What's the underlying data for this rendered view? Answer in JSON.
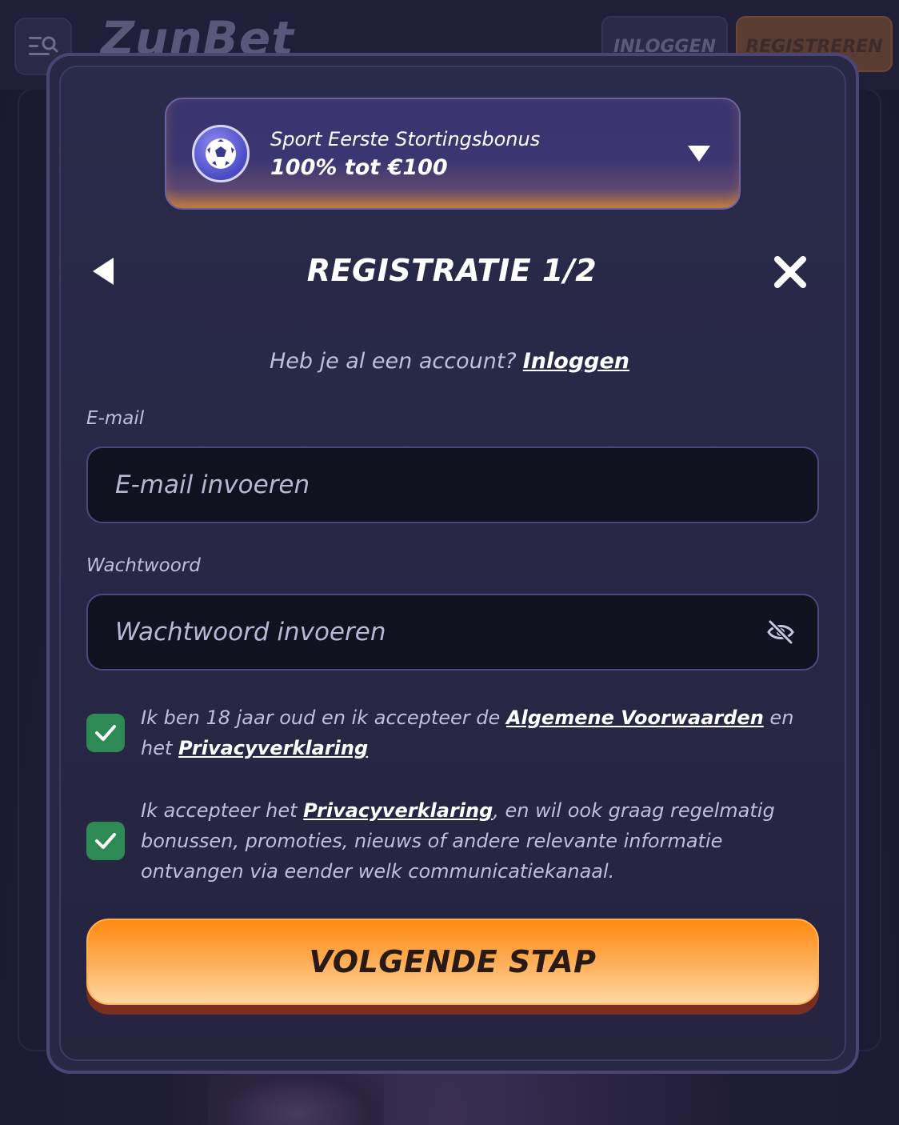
{
  "header": {
    "logo_text": "ZunBet",
    "login_label": "INLOGGEN",
    "register_label": "REGISTREREN"
  },
  "bonus": {
    "line1": "Sport Eerste Stortingsbonus",
    "line2": "100% tot €100",
    "icon": "soccer-ball-icon"
  },
  "modal": {
    "title": "REGISTRATIE 1/2",
    "have_account": "Heb je al een account?",
    "login_link": "Inloggen"
  },
  "form": {
    "email_label": "E-mail",
    "email_placeholder": "E-mail invoeren",
    "email_value": "",
    "password_label": "Wachtwoord",
    "password_placeholder": "Wachtwoord invoeren",
    "password_value": ""
  },
  "consents": {
    "terms": {
      "checked": true,
      "text_before": "Ik ben 18 jaar oud en ik accepteer de",
      "link1": "Algemene Voorwaarden",
      "text_middle": "en het",
      "link2": "Privacyverklaring"
    },
    "marketing": {
      "checked": true,
      "text_before": "Ik accepteer het",
      "link": "Privacyverklaring",
      "text_after": ", en wil ook graag regelmatig bonussen, promoties, nieuws of andere relevante informatie ontvangen via eender welk communicatiekanaal."
    }
  },
  "cta": {
    "label": "VOLGENDE STAP"
  },
  "colors": {
    "accent_orange": "#ff8a12",
    "checkbox_green": "#2e8a55",
    "modal_bg": "#282746"
  }
}
